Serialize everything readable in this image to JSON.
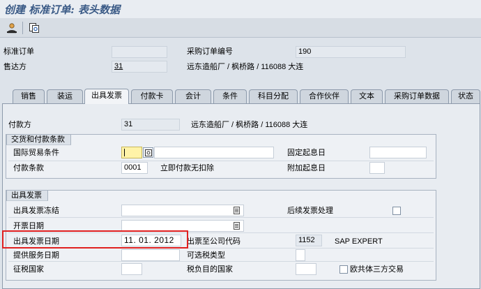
{
  "window": {
    "title": "创建 标准订单: 表头数据"
  },
  "toolbar": {
    "buttons": [
      "person-icon",
      "document-overview-icon"
    ]
  },
  "header": {
    "std_order_label": "标准订单",
    "std_order_value": "",
    "sold_to_label": "售达方",
    "sold_to_value": "31",
    "po_number_label": "采购订单编号",
    "po_number_value": "190",
    "sold_to_desc": "远东造船厂 / 枫桥路 / 116088 大连"
  },
  "tabs": [
    {
      "label": "销售"
    },
    {
      "label": "装运"
    },
    {
      "label": "出具发票"
    },
    {
      "label": "付款卡"
    },
    {
      "label": "会计"
    },
    {
      "label": "条件"
    },
    {
      "label": "科目分配"
    },
    {
      "label": "合作伙伴"
    },
    {
      "label": "文本"
    },
    {
      "label": "采购订单数据"
    },
    {
      "label": "状态"
    }
  ],
  "pane": {
    "payer_label": "付款方",
    "payer_value": "31",
    "payer_desc": "远东造船厂 / 枫桥路 / 116088 大连",
    "delivery_group": {
      "title": "交货和付款条款",
      "incoterms_label": "国际贸易条件",
      "incoterms_value": "",
      "incoterms_desc": "",
      "fixed_date_label": "固定起息日",
      "fixed_date_value": "",
      "payment_terms_label": "付款条款",
      "payment_terms_value": "0001",
      "payment_terms_desc": "立即付款无扣除",
      "add_date_label": "附加起息日",
      "add_date_value": ""
    },
    "billing_group": {
      "title": "出具发票",
      "billing_block_label": "出具发票冻结",
      "billing_block_value": "",
      "subseq_invoice_label": "后续发票处理",
      "invoice_dates_label": "开票日期",
      "invoice_dates_value": "",
      "billing_date_label": "出具发票日期",
      "billing_date_value": "11. 01. 2012",
      "company_code_label": "出票至公司代码",
      "company_code_value": "1152",
      "company_code_desc": "SAP EXPERT",
      "service_date_label": "提供服务日期",
      "service_date_value": "",
      "tax_class_label": "可选税类型",
      "tax_class_value": "",
      "tax_country_label": "征税国家",
      "tax_country_value": "",
      "tax_dest_label": "税负目的国家",
      "tax_dest_value": "",
      "eu_triangular_label": "欧共体三方交易"
    }
  },
  "colors": {
    "title": "#3a5a86",
    "highlight": "#e02020",
    "bg": "#dde3ea"
  }
}
